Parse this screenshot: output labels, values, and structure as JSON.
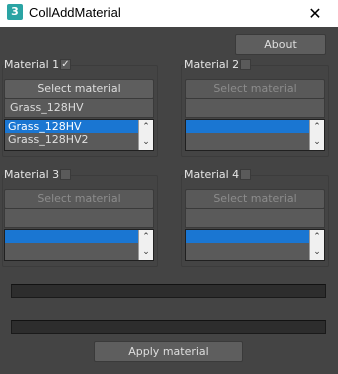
{
  "window": {
    "title": "CollAddMaterial",
    "icon_label": "3",
    "close_glyph": "✕"
  },
  "about_button": "About",
  "materials": [
    {
      "label": "Material 1",
      "checked": true,
      "check_glyph": "✓",
      "select_button": "Select material",
      "enabled": true,
      "current": "Grass_128HV",
      "list": [
        "Grass_128HV",
        "Grass_128HV2"
      ],
      "selected_index": 0
    },
    {
      "label": "Material 2",
      "checked": false,
      "select_button": "Select material",
      "enabled": false,
      "current": "",
      "list": [
        ""
      ],
      "selected_index": 0
    },
    {
      "label": "Material 3",
      "checked": false,
      "select_button": "Select material",
      "enabled": false,
      "current": "",
      "list": [
        ""
      ],
      "selected_index": 0
    },
    {
      "label": "Material 4",
      "checked": false,
      "select_button": "Select material",
      "enabled": false,
      "current": "",
      "list": [
        ""
      ],
      "selected_index": 0
    }
  ],
  "spinner": {
    "up_glyph": "⌃",
    "down_glyph": "⌄"
  },
  "apply_button": "Apply material",
  "colors": {
    "background": "#444444",
    "selection": "#1a76d2",
    "button": "#5e5e5e"
  }
}
